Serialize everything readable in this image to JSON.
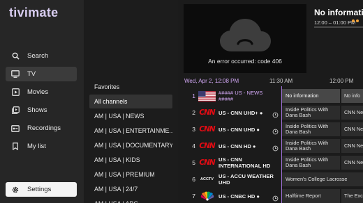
{
  "app": {
    "logo": "tivimate"
  },
  "nav": {
    "items": [
      {
        "label": "Search",
        "icon": "search-icon"
      },
      {
        "label": "TV",
        "icon": "tv-icon"
      },
      {
        "label": "Movies",
        "icon": "movies-icon"
      },
      {
        "label": "Shows",
        "icon": "shows-icon"
      },
      {
        "label": "Recordings",
        "icon": "recordings-icon"
      },
      {
        "label": "My list",
        "icon": "bookmark-icon"
      }
    ],
    "settings": {
      "label": "Settings",
      "icon": "gear-icon"
    }
  },
  "groups": {
    "items": [
      "Favorites",
      "All channels",
      "AM | USA | NEWS",
      "AM | USA | ENTERTAINME...",
      "AM | USA | DOCUMENTARY",
      "AM | USA | KIDS",
      "AM | USA | PREMIUM",
      "AM | USA | 24/7",
      "AM | USA | ABC"
    ],
    "selected_index": 1
  },
  "player": {
    "error": "An error occurred: code 406",
    "icon": "cloud-error-icon"
  },
  "info": {
    "title": "No information",
    "time": "12:00 – 01:00 PM"
  },
  "epg": {
    "date": "Wed, Apr 2, 12:08 PM",
    "times": [
      "11:30 AM",
      "12:00 PM"
    ],
    "rows": [
      {
        "num": "1",
        "name": "##### US - NEWS #####",
        "logo": "us-flag",
        "current": "No information",
        "next": "No info",
        "highlight": true,
        "archive": false
      },
      {
        "num": "2",
        "name": "US - CNN UHD+ ●",
        "logo": "cnn",
        "current": "Inside Politics With Dana Bash",
        "next": "CNN Newsroom",
        "highlight": false,
        "archive": true
      },
      {
        "num": "3",
        "name": "US - CNN UHD ●",
        "logo": "cnn",
        "current": "Inside Politics With Dana Bash",
        "next": "CNN Newsroom",
        "highlight": false,
        "archive": true
      },
      {
        "num": "4",
        "name": "US - CNN HD ●",
        "logo": "cnn",
        "current": "Inside Politics With Dana Bash",
        "next": "CNN Newsroom",
        "highlight": false,
        "archive": true
      },
      {
        "num": "5",
        "name": "US - CNN INTERNATIONAL HD",
        "logo": "cnn",
        "current": "Inside Politics With Dana Bash",
        "next": "CNN Newsroom",
        "highlight": false,
        "archive": false
      },
      {
        "num": "6",
        "name": "US - ACCU WEATHER UHD",
        "logo": "accuweather",
        "current": "Women's College Lacrosse",
        "next": "",
        "highlight": false,
        "archive": false,
        "wide": true
      },
      {
        "num": "7",
        "name": "US - CNBC HD ●",
        "logo": "nbc",
        "current": "Halftime Report",
        "next": "The Exchange",
        "highlight": false,
        "archive": true
      }
    ],
    "accu_logo_text": "ACCTV"
  },
  "colors": {
    "accent": "#d2a8f5",
    "cnn_red": "#e30b13",
    "background": "#1b1b1b"
  }
}
